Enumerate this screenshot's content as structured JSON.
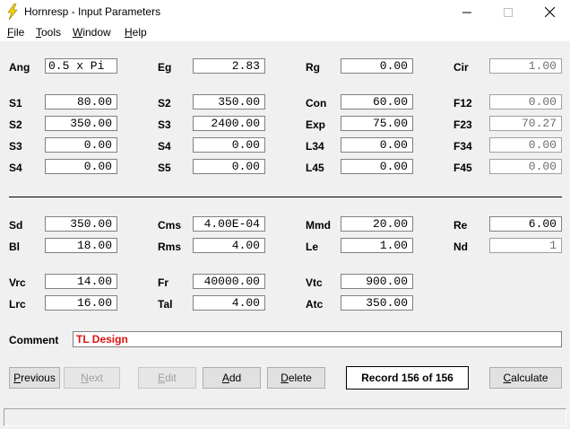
{
  "window": {
    "title": "Hornresp - Input Parameters",
    "accent_icon_color": "#f5d400"
  },
  "menu": {
    "file": {
      "accel": "F",
      "rest": "ile"
    },
    "tools": {
      "accel": "T",
      "rest": "ools"
    },
    "window": {
      "accel": "W",
      "rest": "indow"
    },
    "help": {
      "accel": "H",
      "rest": "elp"
    }
  },
  "horn": {
    "ang": {
      "label": "Ang",
      "value": "0.5 x Pi"
    },
    "eg": {
      "label": "Eg",
      "value": "2.83"
    },
    "rg": {
      "label": "Rg",
      "value": "0.00"
    },
    "cir": {
      "label": "Cir",
      "value": "1.00"
    },
    "s1": {
      "label": "S1",
      "value": "80.00"
    },
    "s2a": {
      "label": "S2",
      "value": "350.00"
    },
    "con": {
      "label": "Con",
      "value": "60.00"
    },
    "f12": {
      "label": "F12",
      "value": "0.00"
    },
    "s2b": {
      "label": "S2",
      "value": "350.00"
    },
    "s3a": {
      "label": "S3",
      "value": "2400.00"
    },
    "exp": {
      "label": "Exp",
      "value": "75.00"
    },
    "f23": {
      "label": "F23",
      "value": "70.27"
    },
    "s3b": {
      "label": "S3",
      "value": "0.00"
    },
    "s4a": {
      "label": "S4",
      "value": "0.00"
    },
    "l34": {
      "label": "L34",
      "value": "0.00"
    },
    "f34": {
      "label": "F34",
      "value": "0.00"
    },
    "s4b": {
      "label": "S4",
      "value": "0.00"
    },
    "s5": {
      "label": "S5",
      "value": "0.00"
    },
    "l45": {
      "label": "L45",
      "value": "0.00"
    },
    "f45": {
      "label": "F45",
      "value": "0.00"
    }
  },
  "driver": {
    "sd": {
      "label": "Sd",
      "value": "350.00"
    },
    "cms": {
      "label": "Cms",
      "value": "4.00E-04"
    },
    "mmd": {
      "label": "Mmd",
      "value": "20.00"
    },
    "re": {
      "label": "Re",
      "value": "6.00"
    },
    "bl": {
      "label": "Bl",
      "value": "18.00"
    },
    "rms": {
      "label": "Rms",
      "value": "4.00"
    },
    "le": {
      "label": "Le",
      "value": "1.00"
    },
    "nd": {
      "label": "Nd",
      "value": "1"
    },
    "vrc": {
      "label": "Vrc",
      "value": "14.00"
    },
    "fr": {
      "label": "Fr",
      "value": "40000.00"
    },
    "vtc": {
      "label": "Vtc",
      "value": "900.00"
    },
    "lrc": {
      "label": "Lrc",
      "value": "16.00"
    },
    "tal": {
      "label": "Tal",
      "value": "4.00"
    },
    "atc": {
      "label": "Atc",
      "value": "350.00"
    }
  },
  "comment": {
    "label": "Comment",
    "value": "TL Design",
    "color": "#e01010"
  },
  "buttons": {
    "previous": {
      "accel": "P",
      "rest": "revious"
    },
    "next": {
      "accel": "N",
      "rest": "ext"
    },
    "edit": {
      "accel": "E",
      "rest": "dit"
    },
    "add": {
      "accel": "A",
      "rest": "dd"
    },
    "delete": {
      "accel": "D",
      "rest": "elete"
    },
    "calculate": {
      "accel": "C",
      "rest": "alculate"
    }
  },
  "record": "Record 156 of 156"
}
